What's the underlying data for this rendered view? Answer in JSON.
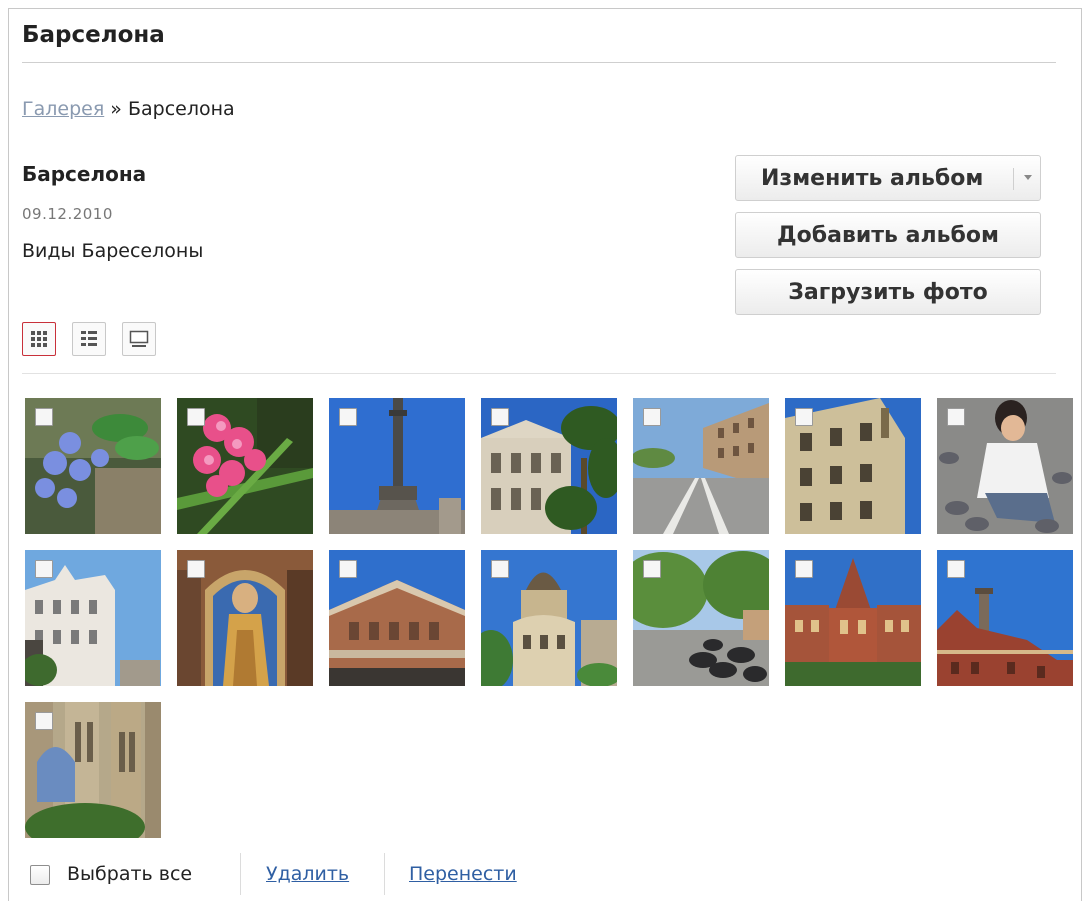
{
  "page": {
    "title": "Барселона"
  },
  "breadcrumb": {
    "parent": "Галерея",
    "separator": "»",
    "current": "Барселона"
  },
  "album": {
    "name": "Барселона",
    "date": "09.12.2010",
    "description": "Виды Бареселоны"
  },
  "actions": {
    "edit_album": "Изменить альбом",
    "add_album": "Добавить альбом",
    "upload_photo": "Загрузить фото"
  },
  "view_modes": [
    {
      "icon": "grid-view-icon",
      "active": true
    },
    {
      "icon": "list-view-icon",
      "active": false
    },
    {
      "icon": "slideshow-view-icon",
      "active": false
    }
  ],
  "photos": [
    {
      "subject": "blue flowers",
      "checked": false
    },
    {
      "subject": "pink flowers",
      "checked": false
    },
    {
      "subject": "columbus monument",
      "checked": false
    },
    {
      "subject": "building with palm tree",
      "checked": false
    },
    {
      "subject": "street",
      "checked": false
    },
    {
      "subject": "apartment building",
      "checked": false
    },
    {
      "subject": "girl with pigeons",
      "checked": false
    },
    {
      "subject": "white ornate building",
      "checked": false
    },
    {
      "subject": "saint mosaic",
      "checked": false
    },
    {
      "subject": "brick church facade",
      "checked": false
    },
    {
      "subject": "domed building",
      "checked": false
    },
    {
      "subject": "tree-lined street with motorbikes",
      "checked": false
    },
    {
      "subject": "hospital de sant pau",
      "checked": false
    },
    {
      "subject": "brick pavilion",
      "checked": false
    },
    {
      "subject": "sagrada familia towers",
      "checked": false
    }
  ],
  "footer": {
    "select_all": "Выбрать все",
    "delete": "Удалить",
    "move": "Перенести"
  },
  "colors": {
    "link": "#2f5fa3",
    "breadcrumb_link": "#8a9ab0",
    "active_view": "#c8303a"
  }
}
